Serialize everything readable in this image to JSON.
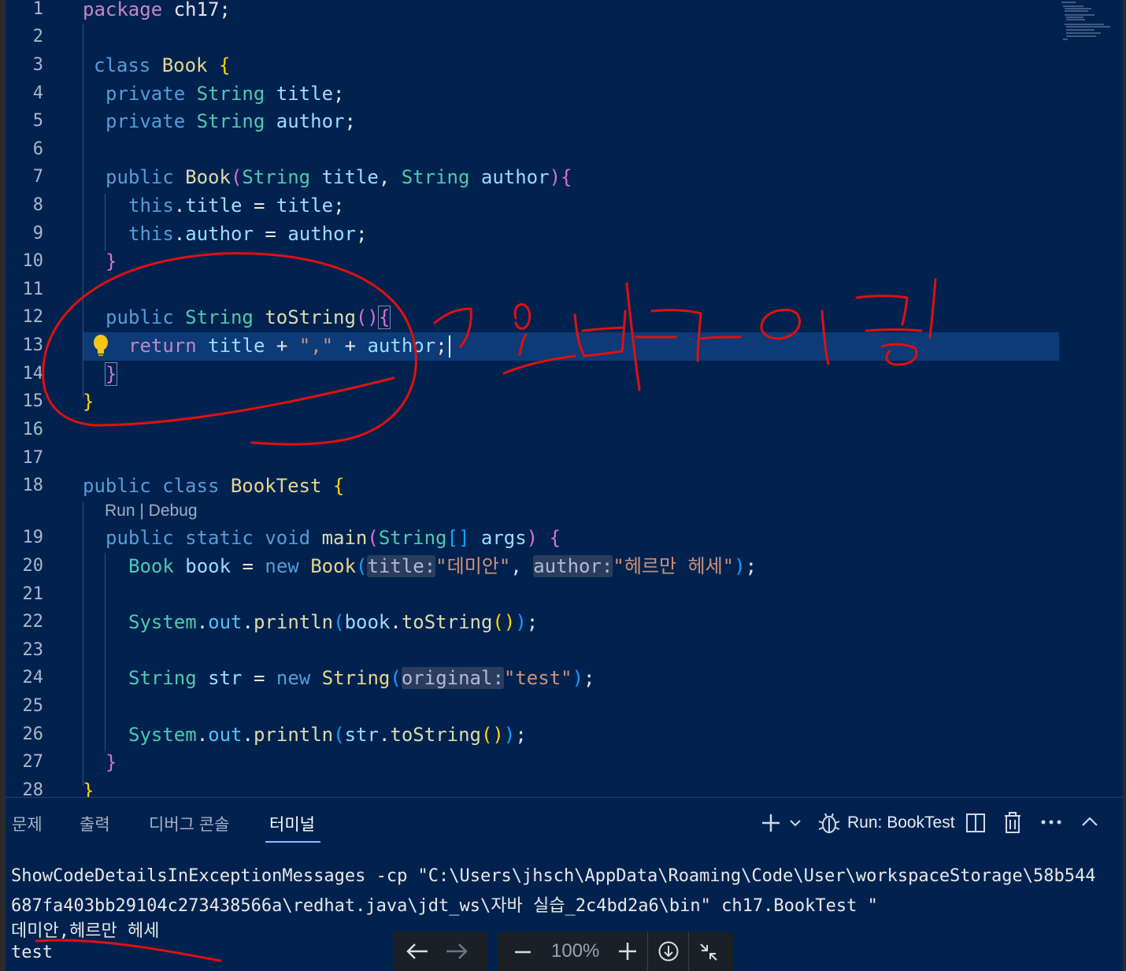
{
  "editor": {
    "line_numbers": [
      "1",
      "2",
      "3",
      "4",
      "5",
      "6",
      "7",
      "8",
      "9",
      "10",
      "11",
      "12",
      "13",
      "14",
      "15",
      "16",
      "17",
      "18",
      "19",
      "20",
      "21",
      "22",
      "23",
      "24",
      "25",
      "26",
      "27",
      "28"
    ],
    "codelens": "Run | Debug",
    "lines": {
      "l1_kw": "package",
      "l1_rest": " ch17;",
      "l3_kw": "class",
      "l3_name": "Book",
      "l3_brace": "{",
      "l4_kw": "private",
      "l4_ty": "String",
      "l4_var": "title",
      "l4_end": ";",
      "l5_kw": "private",
      "l5_ty": "String",
      "l5_var": "author",
      "l5_end": ";",
      "l7_kw": "public",
      "l7_fn": "Book",
      "l7_open": "(",
      "l7_t1": "String",
      "l7_p1": "title",
      "l7_comma": ", ",
      "l7_t2": "String",
      "l7_p2": "author",
      "l7_close": ")",
      "l7_brace": "{",
      "l8_this": "this",
      "l8_dot": ".",
      "l8_prop": "title",
      "l8_eq": " = ",
      "l8_var": "title",
      "l8_end": ";",
      "l9_this": "this",
      "l9_dot": ".",
      "l9_prop": "author",
      "l9_eq": " = ",
      "l9_var": "author",
      "l9_end": ";",
      "l10_brace": "}",
      "l12_kw": "public",
      "l12_ty": "String",
      "l12_fn": "toString",
      "l12_paren": "()",
      "l12_brace": "{",
      "l13_kw": "return",
      "l13_v1": "title",
      "l13_plus1": " + ",
      "l13_str": "\",\"",
      "l13_plus2": " + ",
      "l13_v2": "author",
      "l13_end": ";",
      "l14_brace": "}",
      "l15_brace": "}",
      "l18_kw1": "public",
      "l18_kw2": "class",
      "l18_name": "BookTest",
      "l18_brace": "{",
      "l19_kw1": "public",
      "l19_kw2": "static",
      "l19_kw3": "void",
      "l19_fn": "main",
      "l19_open": "(",
      "l19_ty": "String",
      "l19_arr": "[]",
      "l19_var": "args",
      "l19_close": ")",
      "l19_brace": "{",
      "l20_ty": "Book",
      "l20_var": "book",
      "l20_eq": " = ",
      "l20_new": "new",
      "l20_cls": "Book",
      "l20_open": "(",
      "l20_hint1": "title:",
      "l20_s1": "\"데미안\"",
      "l20_comma": ", ",
      "l20_hint2": "author:",
      "l20_s2": "\"헤르만 헤세\"",
      "l20_close": ")",
      "l20_end": ";",
      "l22_cls": "System",
      "l22_dot1": ".",
      "l22_out": "out",
      "l22_dot2": ".",
      "l22_fn": "println",
      "l22_open": "(",
      "l22_var": "book",
      "l22_dot3": ".",
      "l22_fn2": "toString",
      "l22_paren": "()",
      "l22_close": ")",
      "l22_end": ";",
      "l24_ty": "String",
      "l24_var": "str",
      "l24_eq": " = ",
      "l24_new": "new",
      "l24_cls": "String",
      "l24_open": "(",
      "l24_hint": "original:",
      "l24_str": "\"test\"",
      "l24_close": ")",
      "l24_end": ";",
      "l26_cls": "System",
      "l26_dot1": ".",
      "l26_out": "out",
      "l26_dot2": ".",
      "l26_fn": "println",
      "l26_open": "(",
      "l26_var": "str",
      "l26_dot3": ".",
      "l26_fn2": "toString",
      "l26_paren": "()",
      "l26_close": ")",
      "l26_end": ";",
      "l27_brace": "}",
      "l28_brace": "}"
    }
  },
  "panel": {
    "tabs": [
      "문제",
      "출력",
      "디버그 콘솔",
      "터미널"
    ],
    "active_tab": "터미널",
    "run_label": "Run: BookTest",
    "icons": [
      "plus-icon",
      "chevron-down-icon",
      "debug-icon",
      "split-icon",
      "trash-icon",
      "more-icon",
      "chevron-up-icon"
    ]
  },
  "terminal": {
    "lines": [
      "ShowCodeDetailsInExceptionMessages -cp \"C:\\Users\\jhsch\\AppData\\Roaming\\Code\\User\\workspaceStorage\\58b544",
      "687fa403bb29104c273438566a\\redhat.java\\jdt_ws\\자바 실습_2c4bd2a6\\bin\" ch17.BookTest \"",
      "데미안,헤르만 헤세",
      "test"
    ]
  },
  "viewer": {
    "zoom": "100%"
  },
  "colors": {
    "background": "#01224f",
    "annotation_ink": "#e01010",
    "current_line": "#0c3b78"
  }
}
